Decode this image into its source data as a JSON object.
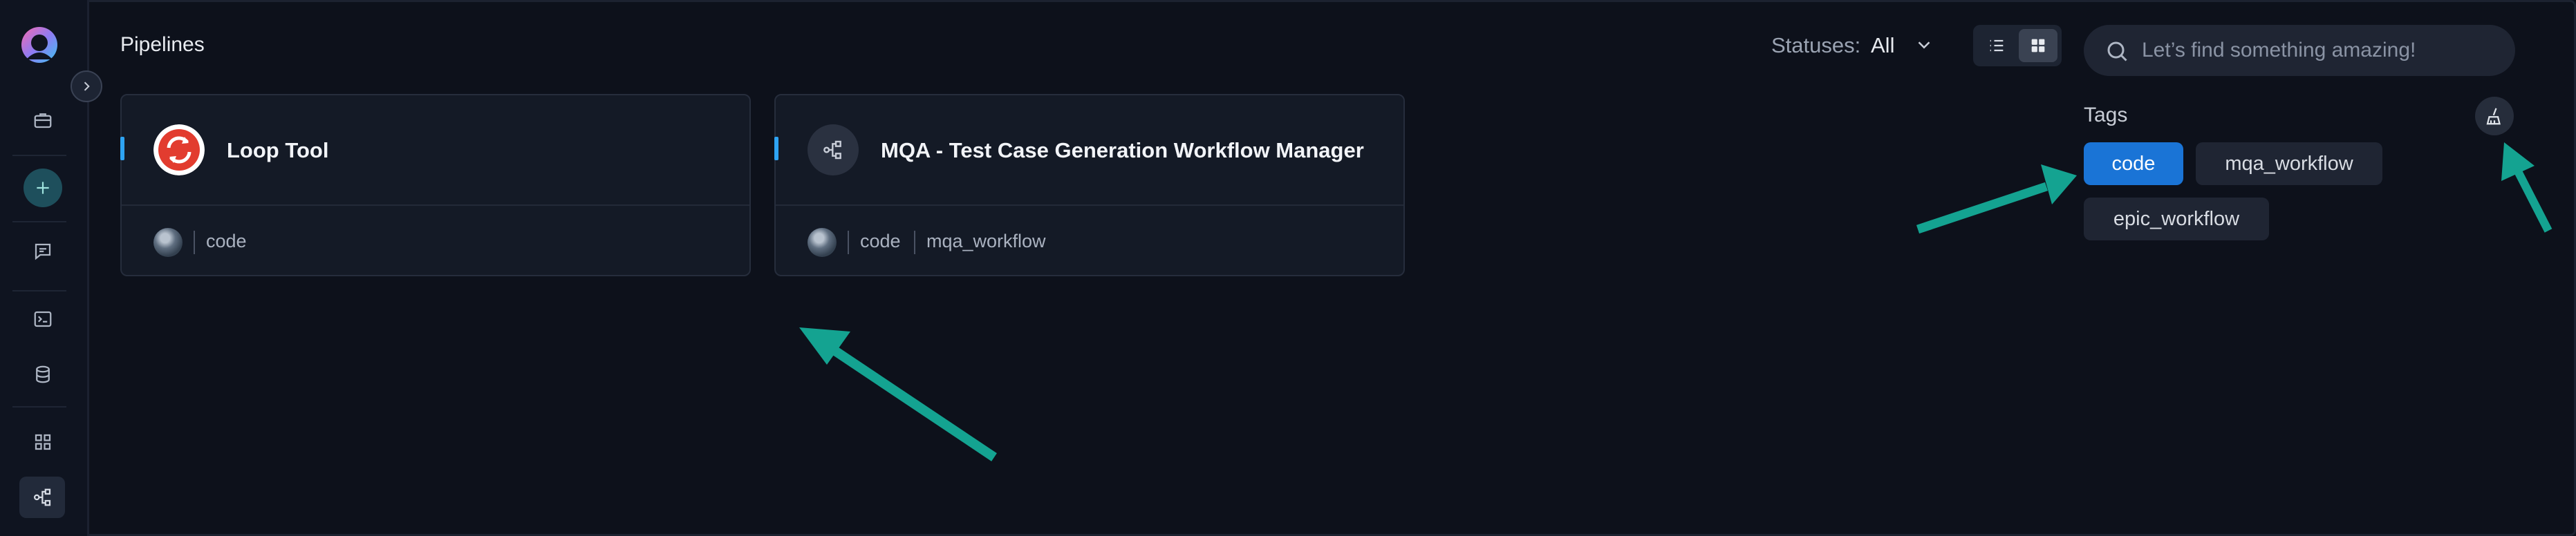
{
  "header": {
    "title": "Pipelines",
    "statuses_label": "Statuses:",
    "statuses_value": "All",
    "search_placeholder": "Let’s find something amazing!"
  },
  "sidebar": {
    "items": [
      {
        "icon": "briefcase-icon"
      },
      {
        "icon": "plus-icon"
      },
      {
        "icon": "chat-icon"
      },
      {
        "icon": "terminal-icon"
      },
      {
        "icon": "database-icon"
      },
      {
        "icon": "grid-icon"
      },
      {
        "icon": "pipeline-icon",
        "active": true
      }
    ]
  },
  "cards": [
    {
      "title": "Loop Tool",
      "tags": [
        "code"
      ],
      "icon": "loop-icon"
    },
    {
      "title": "MQA - Test Case Generation Workflow Manager",
      "tags": [
        "code",
        "mqa_workflow"
      ],
      "icon": "pipeline-icon"
    }
  ],
  "tags_panel": {
    "title": "Tags",
    "tags": [
      {
        "label": "code",
        "selected": true
      },
      {
        "label": "mqa_workflow",
        "selected": false
      },
      {
        "label": "epic_workflow",
        "selected": false
      }
    ]
  },
  "colors": {
    "background": "#0d111b",
    "accent": "#1a74d6",
    "annotation_arrow": "#14a391"
  }
}
